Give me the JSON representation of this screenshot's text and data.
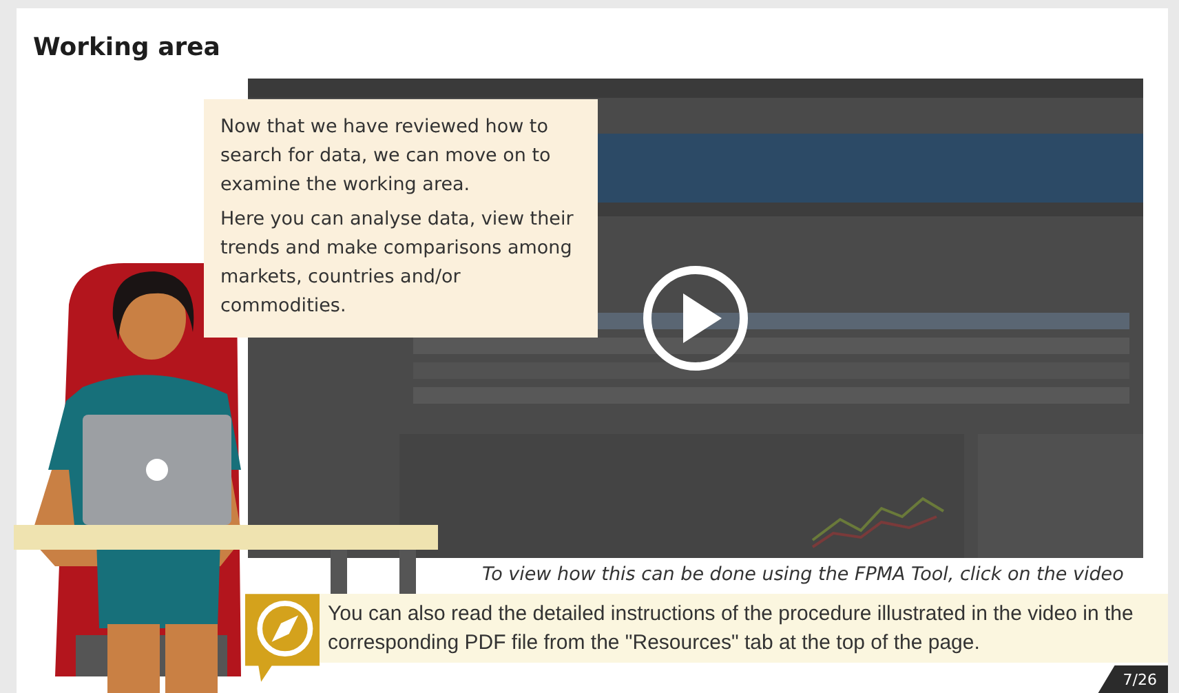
{
  "title": "Working area",
  "speech_bubble": {
    "paragraphs": [
      "Now that we have reviewed how to search for data, we can move on to examine the working area.",
      "Here you can analyse data, view their trends and make comparisons among markets, countries and/or commodities."
    ]
  },
  "caption": "To view how this can be done using the FPMA Tool, click on the video",
  "tip": {
    "text": "You can also read the detailed instructions of the procedure illustrated in the video in the corresponding PDF file from the \"Resources\" tab at the top of the page."
  },
  "page_counter": "7/26"
}
